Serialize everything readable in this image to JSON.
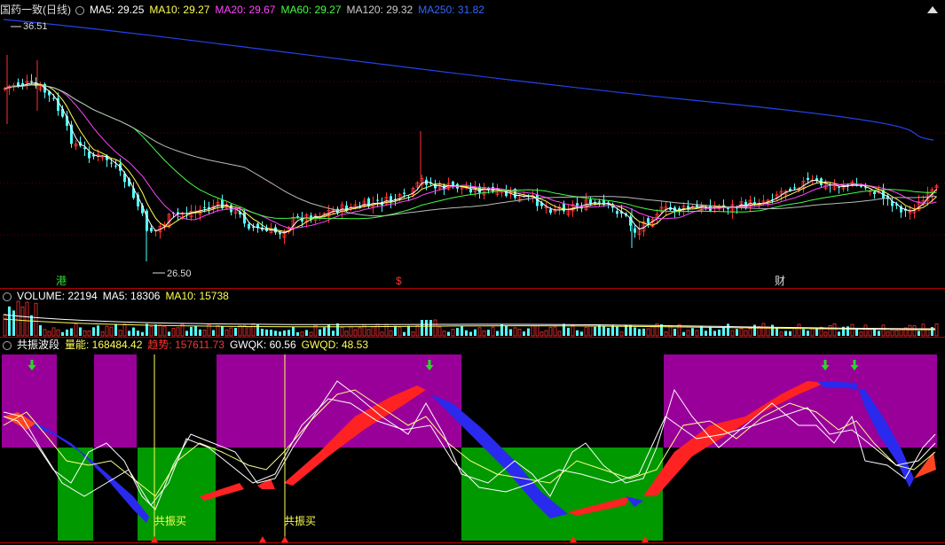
{
  "price_panel": {
    "title": "国药一致(日线)",
    "ma": [
      {
        "label": "MA5: 29.25",
        "color": "#ffffff"
      },
      {
        "label": "MA10: 29.27",
        "color": "#ffff55"
      },
      {
        "label": "MA20: 29.67",
        "color": "#ff44ff"
      },
      {
        "label": "MA60: 29.27",
        "color": "#44ff44"
      },
      {
        "label": "MA120: 29.32",
        "color": "#cccccc"
      },
      {
        "label": "MA250: 31.82",
        "color": "#3366ff"
      }
    ],
    "high_label": "36.51",
    "low_label": "26.50",
    "markers": [
      {
        "label": "港",
        "color": "#33dd33"
      },
      {
        "label": "$",
        "color": "#ff3333"
      },
      {
        "label": "财",
        "color": "#ffffff"
      }
    ]
  },
  "volume_panel": {
    "items": [
      {
        "label": "VOLUME: 22194",
        "color": "#ffffff"
      },
      {
        "label": "MA5: 18306",
        "color": "#ffffff"
      },
      {
        "label": "MA10: 15738",
        "color": "#ffff55"
      }
    ]
  },
  "indicator_panel": {
    "items": [
      {
        "label": "共振波段",
        "color": "#ffffff"
      },
      {
        "label": "量能: 168484.42",
        "color": "#ffff55"
      },
      {
        "label": "趋势: 157611.73",
        "color": "#ff3333"
      },
      {
        "label": "GWQK: 60.56",
        "color": "#ffffff"
      },
      {
        "label": "GWQD: 48.53",
        "color": "#ffff55"
      }
    ],
    "buy_label": "共振买"
  },
  "colors": {
    "up": "#ff3232",
    "down": "#54fcfc",
    "grid": "#800000"
  }
}
